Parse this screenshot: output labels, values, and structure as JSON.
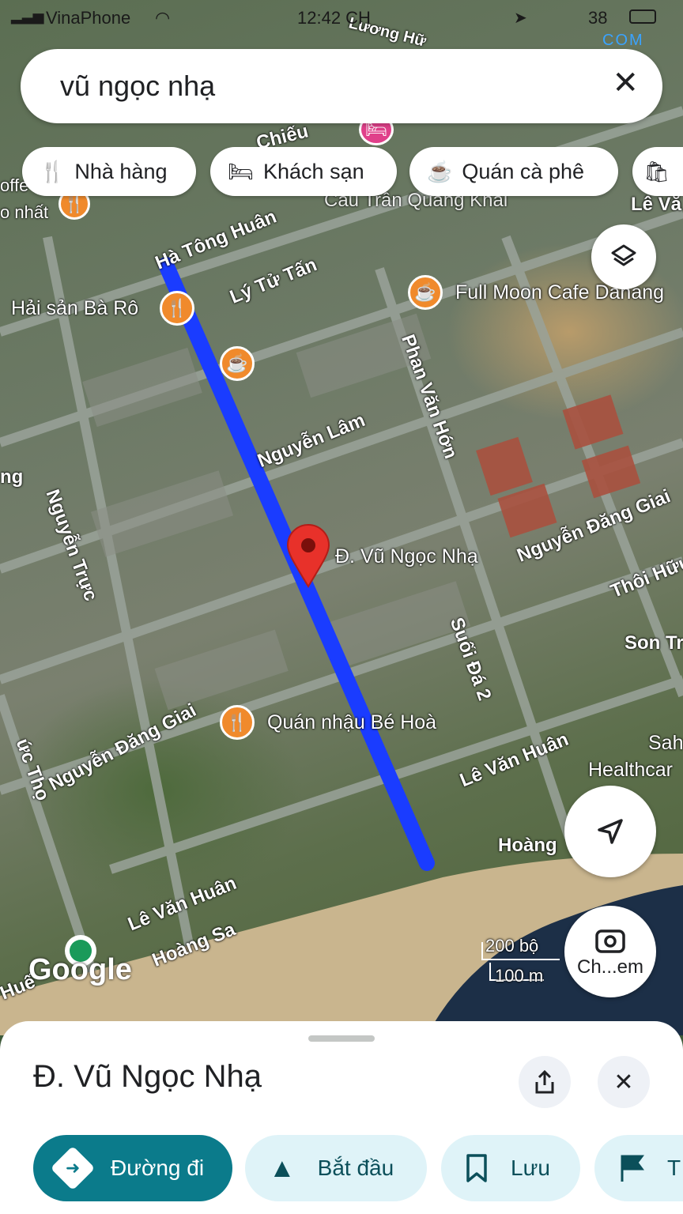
{
  "status_bar": {
    "carrier": "VinaPhone",
    "time": "12:42 CH",
    "battery": "38"
  },
  "watermark": "COM",
  "search": {
    "query": "vũ ngọc nhạ"
  },
  "chips": [
    {
      "label": "Nhà hàng",
      "icon": "restaurant-icon"
    },
    {
      "label": "Khách sạn",
      "icon": "hotel-icon"
    },
    {
      "label": "Quán cà phê",
      "icon": "cafe-icon"
    },
    {
      "label": "",
      "icon": "shopping-icon"
    }
  ],
  "map": {
    "streets": [
      "Hà Tông Huân",
      "Lý Tử Tấn",
      "Nguyễn Lâm",
      "Phan Văn Hớn",
      "Nguyễn Trực",
      "Nguyễn Đăng Giai",
      "Thôi Hữu",
      "Son Tr",
      "Suối Đá 2",
      "Lê Văn Huân",
      "Lê Văn Huân",
      "Hoàng Sa",
      "Hoàng",
      "Nguyễn Đăng Giai",
      "Lương Hữ",
      "Cầu Trần Quang Khải",
      "Lê Vă",
      "Chiếu",
      "ng",
      "ức Thọ",
      "Huế",
      "o nhất",
      "offe"
    ],
    "pois": {
      "hai_san": "Hải sản Bà Rô",
      "full_moon": "Full Moon Cafe Danang",
      "quan_nhau": "Quán nhậu Bé Hoà",
      "pin_label": "Đ. Vũ Ngọc Nhạ",
      "healthcare": "Healthcar",
      "sah": "Sah"
    },
    "scale": {
      "top": "200 bộ",
      "bottom": "100 m"
    },
    "google": "Google",
    "camera_label": "Ch...em"
  },
  "sheet": {
    "title": "Đ. Vũ Ngọc Nhạ",
    "actions": [
      {
        "label": "Đường đi"
      },
      {
        "label": "Bắt đầu"
      },
      {
        "label": "Lưu"
      },
      {
        "label": "T"
      }
    ]
  },
  "colors": {
    "route": "#1a3cff",
    "pin": "#e8312a",
    "poi": "#f08a2c",
    "primary": "#0b7b8b",
    "secondary": "#dff3f8"
  }
}
